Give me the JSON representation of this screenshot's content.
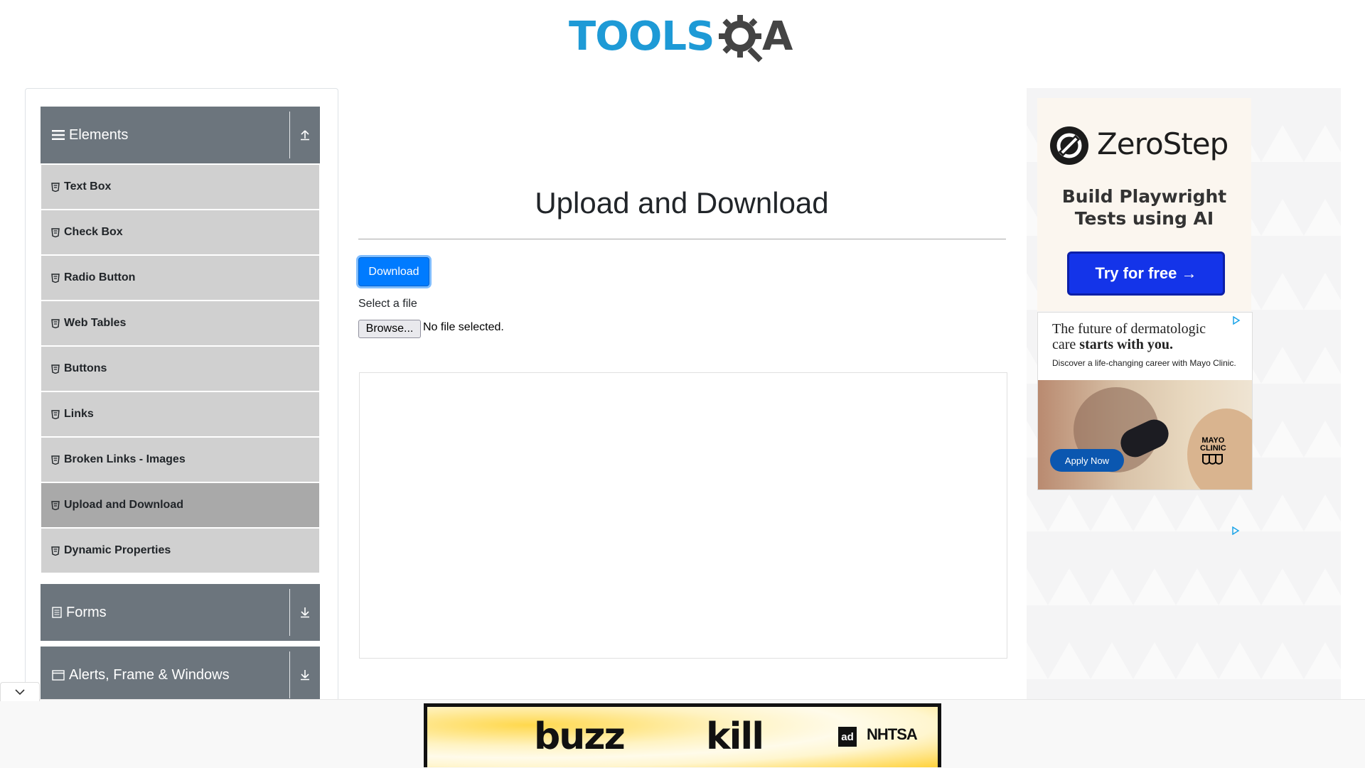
{
  "brand": {
    "logo_text_left": "TOOLS",
    "logo_text_right": "A"
  },
  "sidebar": {
    "groups": [
      {
        "label": "Elements",
        "expanded": true,
        "toggle_icon": "arrow-up-icon"
      },
      {
        "label": "Forms",
        "expanded": false,
        "toggle_icon": "arrow-down-icon"
      },
      {
        "label": "Alerts, Frame & Windows",
        "expanded": false,
        "toggle_icon": "arrow-down-icon"
      }
    ],
    "items": [
      {
        "label": "Text Box"
      },
      {
        "label": "Check Box"
      },
      {
        "label": "Radio Button"
      },
      {
        "label": "Web Tables"
      },
      {
        "label": "Buttons"
      },
      {
        "label": "Links"
      },
      {
        "label": "Broken Links - Images"
      },
      {
        "label": "Upload and Download",
        "active": true
      },
      {
        "label": "Dynamic Properties"
      }
    ]
  },
  "main": {
    "title": "Upload and Download",
    "download_label": "Download",
    "select_label": "Select a file",
    "browse_label": "Browse...",
    "file_status": "No file selected."
  },
  "ads": {
    "zerostep": {
      "brand": "ZeroStep",
      "tagline_line1": "Build Playwright",
      "tagline_line2": "Tests using AI",
      "cta": "Try for free →"
    },
    "mayo": {
      "headline_plain": "The future of dermatologic",
      "headline_line2_plain": "care ",
      "headline_line2_bold": "starts with you.",
      "subline": "Discover a life-changing career with Mayo Clinic.",
      "cta": "Apply Now",
      "brand_line1": "MAYO",
      "brand_line2": "CLINIC"
    },
    "banner": {
      "word1": "buzz",
      "word2": "kill",
      "partner1": "ad",
      "partner2": "NHTSA"
    }
  },
  "colors": {
    "accent": "#007bff",
    "sidebar_header": "#6c757d",
    "menu_item": "#d0d0d0",
    "menu_item_active": "#a9a9a9",
    "logo_blue": "#1e9ad6"
  }
}
